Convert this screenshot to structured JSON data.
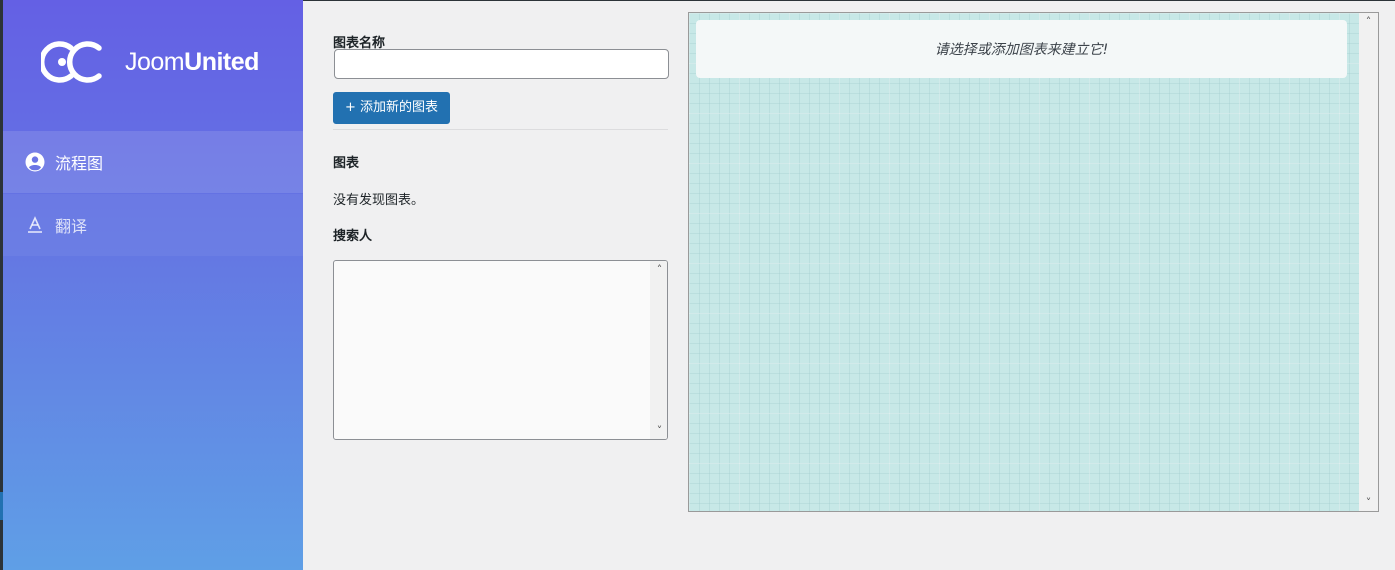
{
  "brand": {
    "logo_text_light": "Joom",
    "logo_text_bold": "United",
    "logo_icon": "joomunited-logo-icon"
  },
  "sidebar": {
    "items": [
      {
        "label": "流程图",
        "icon": "user-circle-icon",
        "active": true
      },
      {
        "label": "翻译",
        "icon": "translate-icon",
        "active": false
      }
    ]
  },
  "form": {
    "chart_name_label": "图表名称",
    "chart_name_value": "",
    "add_button_label": "+ 添加新的图表",
    "charts_heading": "图表",
    "no_charts_text": "没有发现图表。",
    "searcher_heading": "搜索人"
  },
  "canvas": {
    "notice_text": "请选择或添加图表来建立它!"
  },
  "colors": {
    "accent": "#2271b1",
    "sidebar_top": "#6460e4",
    "sidebar_bottom": "#5f9fe6",
    "canvas_bg": "#c7e8e7"
  }
}
